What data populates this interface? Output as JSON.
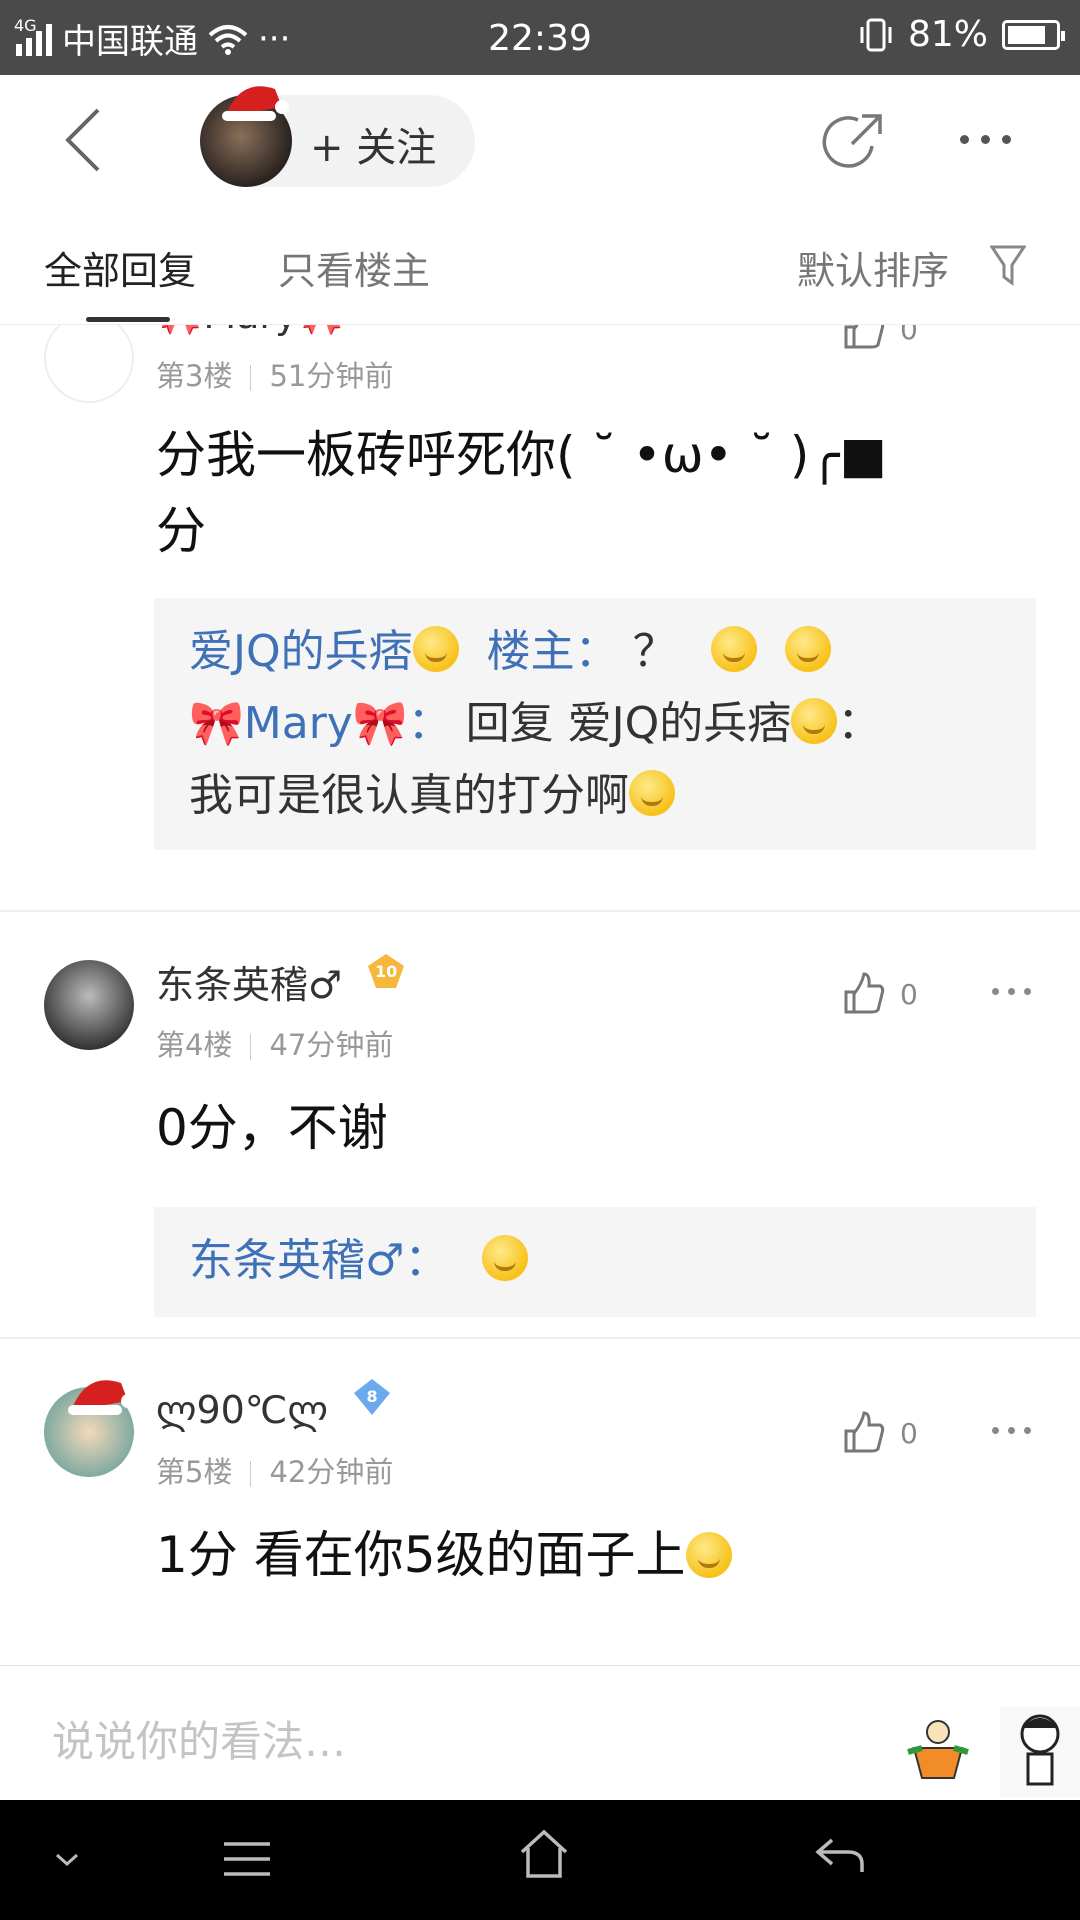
{
  "status_bar": {
    "network": "4G",
    "carrier": "中国联通",
    "more": "···",
    "time": "22:39",
    "battery": "81%",
    "battery_level": 0.81
  },
  "header": {
    "follow_label": "+ 关注"
  },
  "tabs": {
    "all": "全部回复",
    "owner_only": "只看楼主",
    "sort": "默认排序"
  },
  "replies": [
    {
      "username": "🎀Mary🎀",
      "floor": "第3楼",
      "time": "51分钟前",
      "likes": "0",
      "content_line1": "分我一板砖呼死你( ˘ •ω• ˘ )╭■",
      "content_line2": "分",
      "quote": [
        {
          "name": "爱JQ的兵痞",
          "tag": "楼主",
          "colon": "：",
          "text": "？"
        },
        {
          "name": "🎀Mary🎀",
          "colon": "：",
          "text": "回复 爱JQ的兵痞",
          "text_colon": "：",
          "text2": "我可是很认真的打分啊"
        }
      ]
    },
    {
      "username": "东条英稽♂",
      "level": "10",
      "floor": "第4楼",
      "time": "47分钟前",
      "likes": "0",
      "content": "0分，不谢",
      "quote": [
        {
          "name": "东条英稽♂",
          "colon": "："
        }
      ]
    },
    {
      "username": "ლ90℃ლ",
      "level": "8",
      "floor": "第5楼",
      "time": "42分钟前",
      "likes": "0",
      "content": "1分 看在你5级的面子上"
    }
  ],
  "input": {
    "placeholder": "说说你的看法…"
  },
  "colors": {
    "link_blue": "#3f71b8",
    "status_bar": "#4a4a4a",
    "level10": "#f6b73c",
    "level8": "#6aa9ee"
  }
}
